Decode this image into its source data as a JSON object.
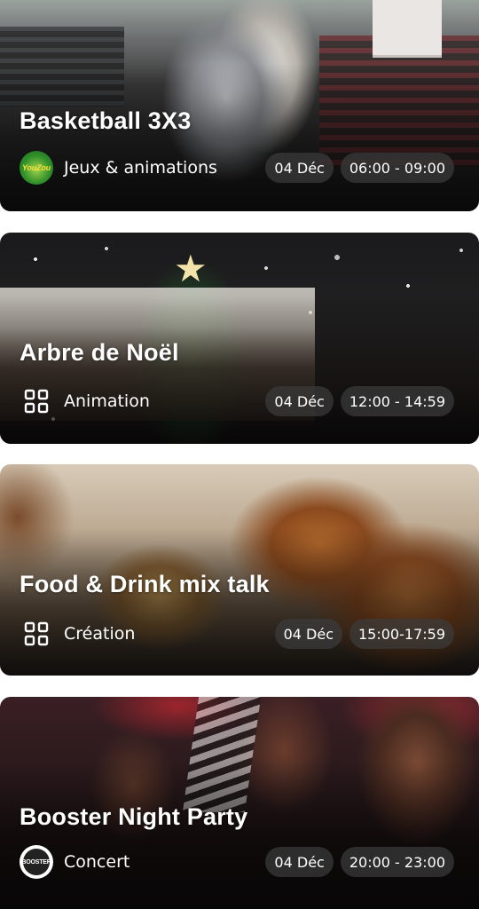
{
  "events": [
    {
      "title": "Basketball 3X3",
      "category": "Jeux & animations",
      "category_icon": "youzou-logo-icon",
      "logo_text": "YouZou",
      "date": "04 Déc",
      "time": "06:00 - 09:00"
    },
    {
      "title": "Arbre de Noël",
      "category": "Animation",
      "category_icon": "grid-icon",
      "date": "04 Déc",
      "time": "12:00 - 14:59"
    },
    {
      "title": "Food & Drink mix talk",
      "category": "Création",
      "category_icon": "grid-icon",
      "date": "04 Déc",
      "time": "15:00-17:59"
    },
    {
      "title": "Booster Night Party",
      "category": "Concert",
      "category_icon": "booster-logo-icon",
      "logo_text": "BOOSTER",
      "date": "04 Déc",
      "time": "20:00 - 23:00"
    }
  ],
  "colors": {
    "chip_background": "#3c3c3c",
    "text": "#ffffff"
  }
}
